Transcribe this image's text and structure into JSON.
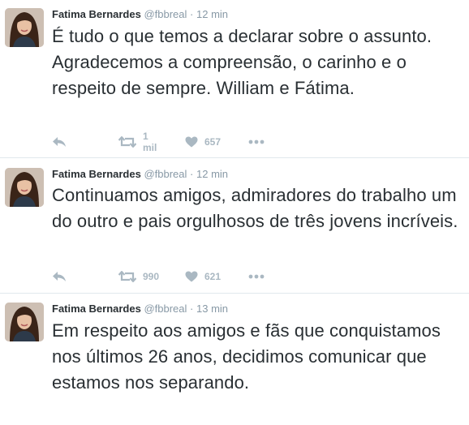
{
  "tweets": [
    {
      "name": "Fatima Bernardes",
      "handle": "@fbbreal",
      "dot": "·",
      "time": "12 min",
      "text": "É tudo o que temos a declarar sobre o assunto. Agradecemos a compreensão, o carinho e o respeito de sempre. William e Fátima.",
      "retweets": "1 mil",
      "likes": "657"
    },
    {
      "name": "Fatima Bernardes",
      "handle": "@fbbreal",
      "dot": "·",
      "time": "12 min",
      "text": "Continuamos amigos, admiradores do trabalho um do outro e pais orgulhosos de três jovens incríveis.",
      "retweets": "990",
      "likes": "621"
    },
    {
      "name": "Fatima Bernardes",
      "handle": "@fbbreal",
      "dot": "·",
      "time": "13 min",
      "text": "Em respeito aos amigos e fãs que conquistamos nos últimos 26 anos, decidimos comunicar que estamos nos separando."
    }
  ],
  "icons": {
    "reply": "reply-icon",
    "retweet": "retweet-icon",
    "like": "heart-icon",
    "more": "more-icon"
  }
}
